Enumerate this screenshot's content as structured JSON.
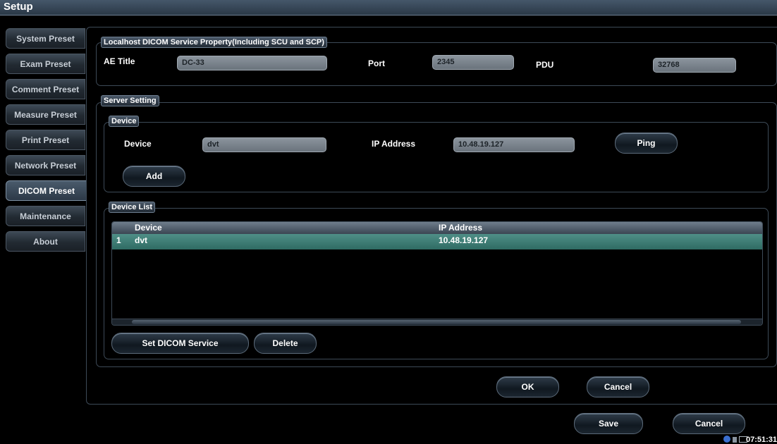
{
  "window": {
    "title": "Setup"
  },
  "sidebar": {
    "items": [
      {
        "label": "System Preset"
      },
      {
        "label": "Exam Preset"
      },
      {
        "label": "Comment Preset"
      },
      {
        "label": "Measure Preset"
      },
      {
        "label": "Print Preset"
      },
      {
        "label": "Network Preset"
      },
      {
        "label": "DICOM Preset",
        "active": true
      },
      {
        "label": "Maintenance"
      },
      {
        "label": "About"
      }
    ]
  },
  "localhost": {
    "legend": "Localhost DICOM Service Property(Including SCU and SCP)",
    "ae_title_label": "AE Title",
    "ae_title_value": "DC-33",
    "port_label": "Port",
    "port_value": "2345",
    "pdu_label": "PDU",
    "pdu_value": "32768"
  },
  "server": {
    "legend": "Server Setting",
    "device_group": {
      "legend": "Device",
      "device_label": "Device",
      "device_value": "dvt",
      "ip_label": "IP Address",
      "ip_value": "10.48.19.127",
      "ping_label": "Ping",
      "add_label": "Add"
    },
    "device_list": {
      "legend": "Device List",
      "columns": [
        "Device",
        "IP Address"
      ],
      "rows": [
        {
          "index": "1",
          "device": "dvt",
          "ip": "10.48.19.127"
        }
      ],
      "set_dicom_label": "Set DICOM Service",
      "delete_label": "Delete"
    }
  },
  "dialog": {
    "ok_label": "OK",
    "cancel_label": "Cancel"
  },
  "footer": {
    "save_label": "Save",
    "cancel_label": "Cancel",
    "time": "07:51:31"
  },
  "colors": {
    "selected_row": "#3f7f77",
    "field_bg": "#7d868f"
  }
}
